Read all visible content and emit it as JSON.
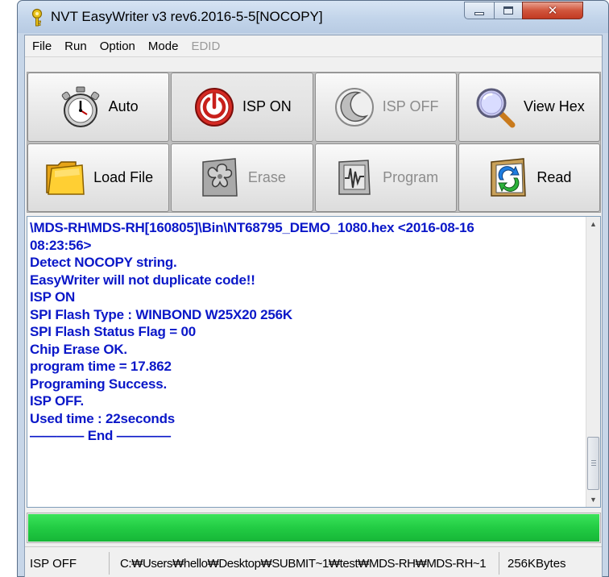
{
  "window": {
    "title": "NVT EasyWriter v3 rev6.2016-5-5[NOCOPY]",
    "app_icon": "key-icon",
    "controls": {
      "minimize": "minimize-icon",
      "maximize": "maximize-icon",
      "close": "close-icon"
    }
  },
  "menu": {
    "items": [
      {
        "label": "File",
        "enabled": true
      },
      {
        "label": "Run",
        "enabled": true
      },
      {
        "label": "Option",
        "enabled": true
      },
      {
        "label": "Mode",
        "enabled": true
      },
      {
        "label": "EDID",
        "enabled": false
      }
    ]
  },
  "toolbar": {
    "buttons": [
      {
        "label": "Auto",
        "icon": "stopwatch-icon",
        "enabled": true
      },
      {
        "label": "ISP ON",
        "icon": "isp-on-icon",
        "enabled": true
      },
      {
        "label": "ISP OFF",
        "icon": "moon-icon",
        "enabled": false
      },
      {
        "label": "View Hex",
        "icon": "magnifier-icon",
        "enabled": true
      },
      {
        "label": "Load File",
        "icon": "folder-icon",
        "enabled": true
      },
      {
        "label": "Erase",
        "icon": "eraser-icon",
        "enabled": false
      },
      {
        "label": "Program",
        "icon": "program-icon",
        "enabled": false
      },
      {
        "label": "Read",
        "icon": "read-folder-icon",
        "enabled": true
      }
    ]
  },
  "log": {
    "lines": [
      "\\MDS-RH\\MDS-RH[160805]\\Bin\\NT68795_DEMO_1080.hex <2016-08-16",
      "08:23:56>",
      "Detect NOCOPY string.",
      "EasyWriter will not duplicate code!!",
      "ISP ON",
      "SPI Flash Type : WINBOND W25X20 256K",
      "SPI Flash Status Flag = 00",
      "Chip Erase OK.",
      "program time = 17.862",
      "Programing Success.",
      "ISP OFF.",
      "Used time : 22seconds",
      "———— End ————"
    ],
    "text_color": "#0a17c8"
  },
  "progress": {
    "value_percent": 100,
    "color": "#22cc44"
  },
  "status": {
    "state": "ISP OFF",
    "path": "C:₩Users₩hello₩Desktop₩SUBMIT~1₩test₩MDS-RH₩MDS-RH~1",
    "size": "256KBytes"
  }
}
